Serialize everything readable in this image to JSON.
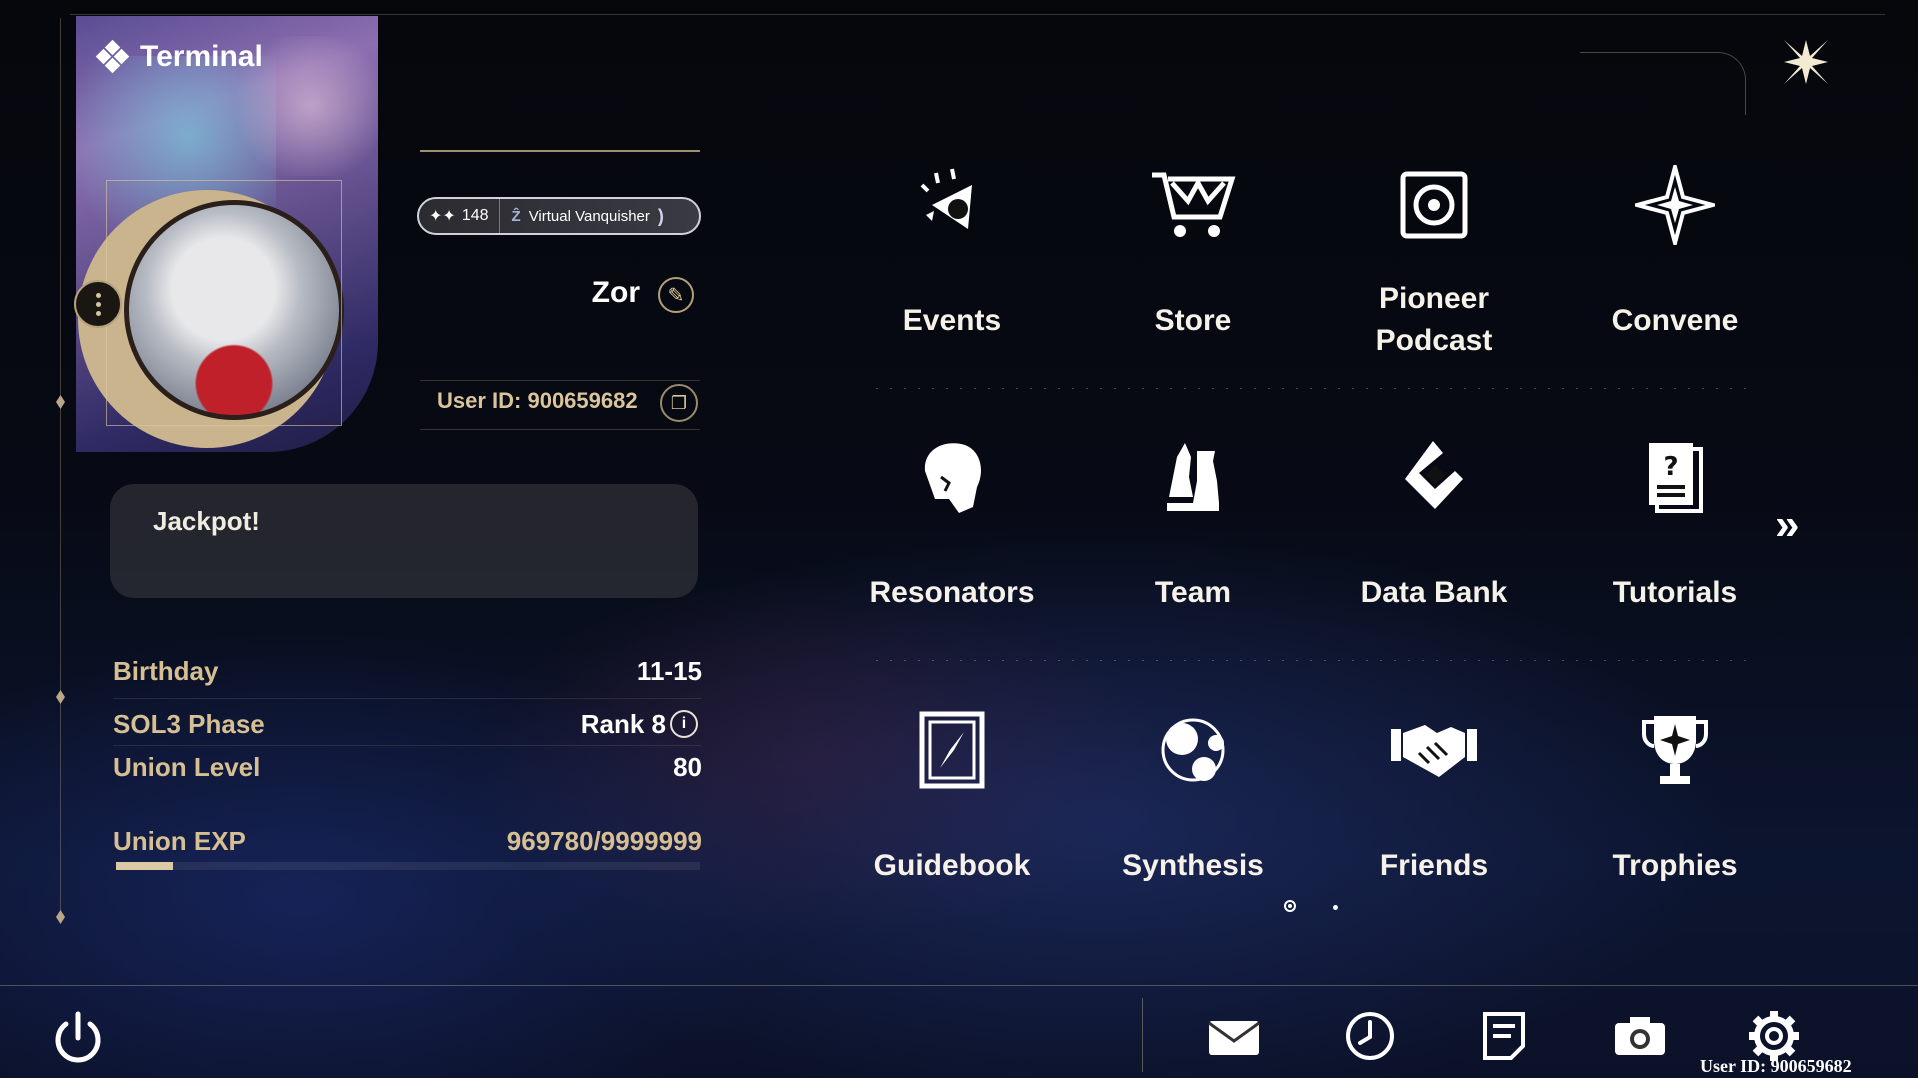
{
  "header": {
    "title": "Terminal"
  },
  "profile": {
    "badge_count": "148",
    "badge_title": "Virtual Vanquisher",
    "name": "Zor",
    "user_id": "User ID: 900659682",
    "signature": "Jackpot!"
  },
  "info": {
    "birthday_label": "Birthday",
    "birthday_value": "11-15",
    "sol3_label": "SOL3 Phase",
    "sol3_value": "Rank 8",
    "union_level_label": "Union Level",
    "union_level_value": "80",
    "union_exp_label": "Union EXP",
    "union_exp_value": "969780/9999999",
    "union_exp_fraction": 0.097
  },
  "grid": [
    {
      "label": "Events",
      "icon": "events-icon"
    },
    {
      "label": "Store",
      "icon": "store-cart-icon"
    },
    {
      "label": "Pioneer\nPodcast",
      "icon": "podcast-icon"
    },
    {
      "label": "Convene",
      "icon": "convene-star-icon"
    },
    {
      "label": "Resonators",
      "icon": "resonator-head-icon"
    },
    {
      "label": "Team",
      "icon": "chess-team-icon"
    },
    {
      "label": "Data Bank",
      "icon": "data-bank-icon"
    },
    {
      "label": "Tutorials",
      "icon": "tutorial-doc-icon"
    },
    {
      "label": "Guidebook",
      "icon": "guidebook-icon"
    },
    {
      "label": "Synthesis",
      "icon": "synthesis-icon"
    },
    {
      "label": "Friends",
      "icon": "handshake-icon"
    },
    {
      "label": "Trophies",
      "icon": "trophy-icon"
    }
  ],
  "pagination": {
    "pages": 2,
    "current": 1
  },
  "footer": {
    "user_id": "User ID: 900659682"
  },
  "colors": {
    "accent_gold": "#d6bf92",
    "text_white": "#f6f2ea"
  }
}
